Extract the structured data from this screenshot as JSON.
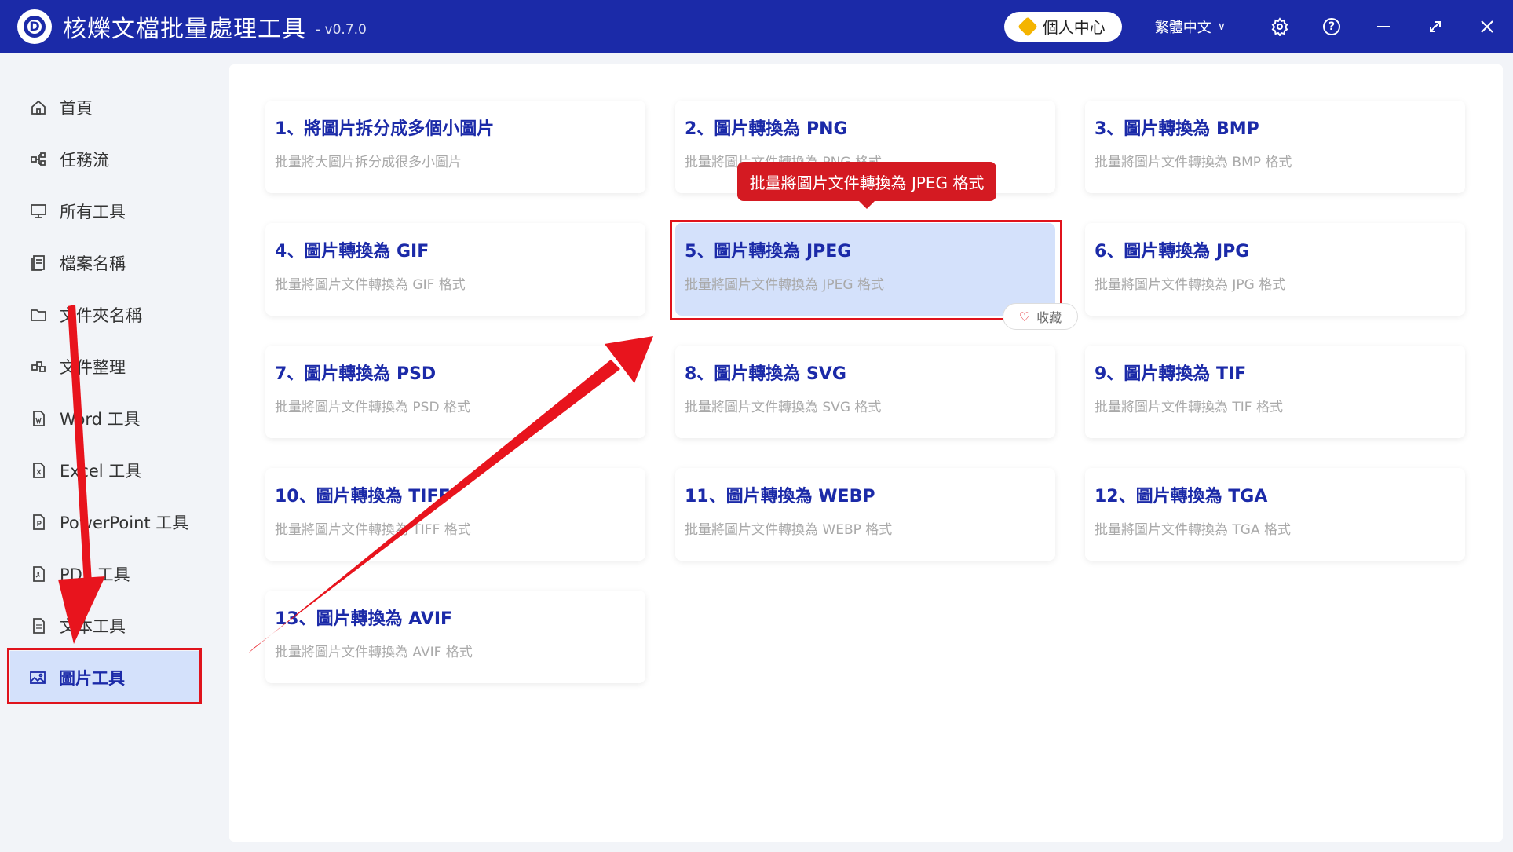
{
  "titlebar": {
    "app_title": "核爍文檔批量處理工具",
    "version": "- v0.7.0",
    "user_center": "個人中心",
    "language": "繁體中文",
    "logo_letter": "D"
  },
  "sidebar": {
    "items": [
      {
        "label": "首頁",
        "icon": "home-icon"
      },
      {
        "label": "任務流",
        "icon": "workflow-icon"
      },
      {
        "label": "所有工具",
        "icon": "monitor-icon"
      },
      {
        "label": "檔案名稱",
        "icon": "file-name-icon"
      },
      {
        "label": "文件夾名稱",
        "icon": "folder-icon"
      },
      {
        "label": "文件整理",
        "icon": "organize-icon"
      },
      {
        "label": "Word 工具",
        "icon": "word-icon"
      },
      {
        "label": "Excel 工具",
        "icon": "excel-icon"
      },
      {
        "label": "PowerPoint 工具",
        "icon": "powerpoint-icon"
      },
      {
        "label": "PDF 工具",
        "icon": "pdf-icon"
      },
      {
        "label": "文本工具",
        "icon": "text-icon"
      },
      {
        "label": "圖片工具",
        "icon": "image-icon",
        "active": true
      }
    ]
  },
  "tools": [
    {
      "title": "1、將圖片拆分成多個小圖片",
      "desc": "批量將大圖片拆分成很多小圖片"
    },
    {
      "title": "2、圖片轉換為 PNG",
      "desc": "批量將圖片文件轉換為 PNG 格式"
    },
    {
      "title": "3、圖片轉換為 BMP",
      "desc": "批量將圖片文件轉換為 BMP 格式"
    },
    {
      "title": "4、圖片轉換為 GIF",
      "desc": "批量將圖片文件轉換為 GIF 格式"
    },
    {
      "title": "5、圖片轉換為 JPEG",
      "desc": "批量將圖片文件轉換為 JPEG 格式"
    },
    {
      "title": "6、圖片轉換為 JPG",
      "desc": "批量將圖片文件轉換為 JPG 格式"
    },
    {
      "title": "7、圖片轉換為 PSD",
      "desc": "批量將圖片文件轉換為 PSD 格式"
    },
    {
      "title": "8、圖片轉換為 SVG",
      "desc": "批量將圖片文件轉換為 SVG 格式"
    },
    {
      "title": "9、圖片轉換為 TIF",
      "desc": "批量將圖片文件轉換為 TIF 格式"
    },
    {
      "title": "10、圖片轉換為 TIFF",
      "desc": "批量將圖片文件轉換為 TIFF 格式"
    },
    {
      "title": "11、圖片轉換為 WEBP",
      "desc": "批量將圖片文件轉換為 WEBP 格式"
    },
    {
      "title": "12、圖片轉換為 TGA",
      "desc": "批量將圖片文件轉換為 TGA 格式"
    },
    {
      "title": "13、圖片轉換為 AVIF",
      "desc": "批量將圖片文件轉換為 AVIF 格式"
    }
  ],
  "tooltip": "批量將圖片文件轉換為 JPEG 格式",
  "favorite_label": "收藏",
  "colors": {
    "titlebar": "#1b2aa8",
    "accent": "#1b2aa8",
    "highlight": "#d4e1fb",
    "annotation": "#e0131c"
  }
}
